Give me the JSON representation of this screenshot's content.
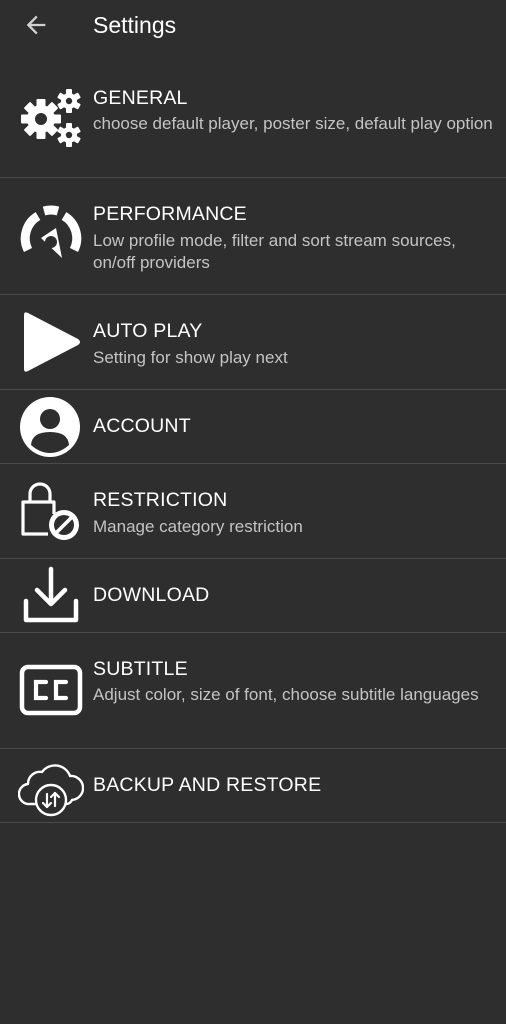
{
  "header": {
    "title": "Settings"
  },
  "items": [
    {
      "key": "general",
      "icon": "gears-icon",
      "label": "GENERAL",
      "desc": "choose default player, poster size, default play option"
    },
    {
      "key": "performance",
      "icon": "speedometer-icon",
      "label": "PERFORMANCE",
      "desc": "Low profile mode, filter and sort stream sources, on/off providers"
    },
    {
      "key": "auto-play",
      "icon": "play-icon",
      "label": "AUTO PLAY",
      "desc": "Setting for show play next"
    },
    {
      "key": "account",
      "icon": "account-icon",
      "label": "ACCOUNT",
      "desc": ""
    },
    {
      "key": "restriction",
      "icon": "lock-restriction-icon",
      "label": "RESTRICTION",
      "desc": "Manage category restriction"
    },
    {
      "key": "download",
      "icon": "download-icon",
      "label": "DOWNLOAD",
      "desc": ""
    },
    {
      "key": "subtitle",
      "icon": "closed-caption-icon",
      "label": "SUBTITLE",
      "desc": "Adjust color, size of font, choose subtitle languages"
    },
    {
      "key": "backup",
      "icon": "cloud-sync-icon",
      "label": "BACKUP AND RESTORE",
      "desc": ""
    }
  ],
  "colors": {
    "background": "#2e2e2e",
    "divider": "#4a4a4a",
    "text": "#ffffff",
    "secondary_text": "#c4c4c4"
  }
}
